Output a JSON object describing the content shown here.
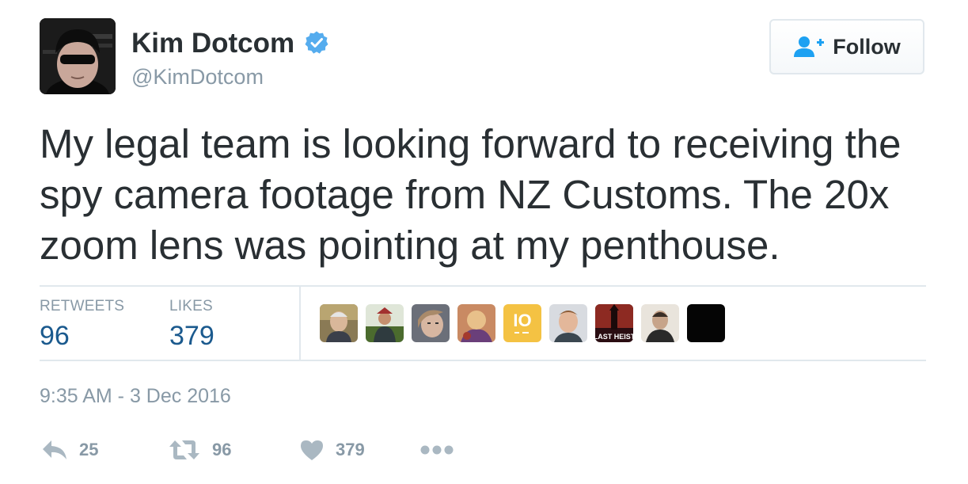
{
  "author": {
    "name": "Kim Dotcom",
    "handle": "@KimDotcom",
    "verified": true,
    "verified_color": "#55acee"
  },
  "follow_button": {
    "label": "Follow",
    "icon": "follow-user-icon",
    "icon_color": "#1da1f2"
  },
  "tweet": {
    "text": "My legal team is looking forward to receiving the spy camera footage from NZ Customs. The 20x zoom lens was pointing at my penthouse.",
    "timestamp": "9:35 AM - 3 Dec 2016"
  },
  "stats": {
    "retweets_label": "RETWEETS",
    "retweets_value": "96",
    "likes_label": "LIKES",
    "likes_value": "379"
  },
  "likers": [
    {
      "icon": "liker-avatar-1"
    },
    {
      "icon": "liker-avatar-2"
    },
    {
      "icon": "liker-avatar-3"
    },
    {
      "icon": "liker-avatar-4"
    },
    {
      "icon": "liker-avatar-5",
      "text": "IO"
    },
    {
      "icon": "liker-avatar-6"
    },
    {
      "icon": "liker-avatar-7",
      "text": "LAST HEIST"
    },
    {
      "icon": "liker-avatar-8"
    },
    {
      "icon": "liker-avatar-9"
    }
  ],
  "actions": {
    "reply_count": "25",
    "retweet_count": "96",
    "like_count": "379",
    "reply_icon": "reply-icon",
    "retweet_icon": "retweet-icon",
    "like_icon": "heart-icon",
    "more_icon": "more-icon"
  },
  "colors": {
    "text": "#292f33",
    "muted": "#8899a6",
    "stat_value": "#1b5a8e",
    "divider": "#e1e8ed"
  }
}
